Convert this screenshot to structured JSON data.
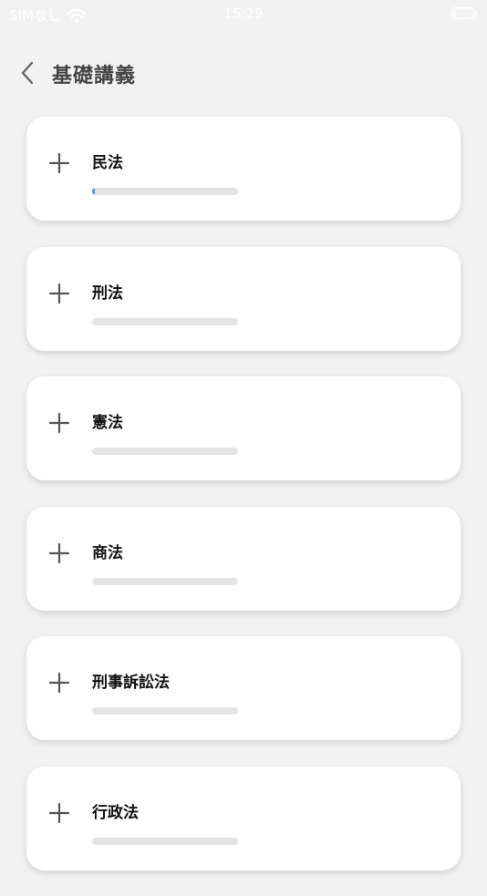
{
  "status_bar": {
    "carrier": "SIMなし",
    "time": "15:29",
    "icons": [
      "wifi-icon",
      "battery-icon"
    ]
  },
  "header": {
    "title": "基礎講義",
    "back_icon": "chevron-left-icon"
  },
  "courses": [
    {
      "label": "民法",
      "progress": 0.01
    },
    {
      "label": "刑法",
      "progress": 0
    },
    {
      "label": "憲法",
      "progress": 0
    },
    {
      "label": "商法",
      "progress": 0
    },
    {
      "label": "刑事訴訟法",
      "progress": 0
    },
    {
      "label": "行政法",
      "progress": 0
    }
  ],
  "colors": {
    "background": "#f2f2f2",
    "card": "#ffffff",
    "title_text": "#444444",
    "label_text": "#111111",
    "progress_track": "#e4e4e4",
    "progress_fill": "#4a9ee8",
    "icon": "#555555"
  }
}
